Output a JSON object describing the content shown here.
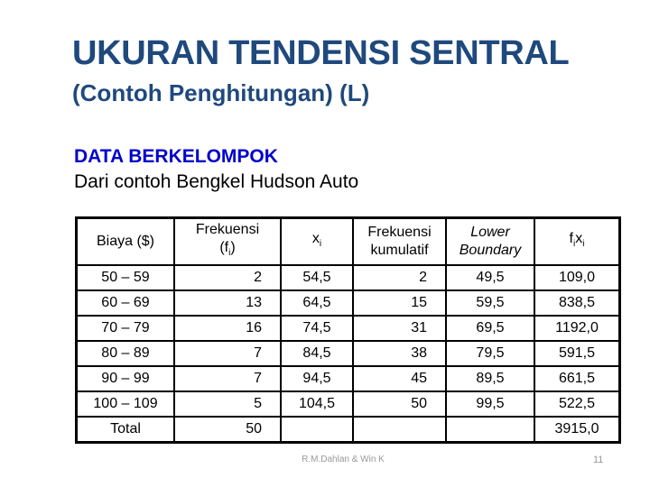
{
  "title": "UKURAN TENDENSI SENTRAL",
  "subtitle": "(Contoh Penghitungan) (L)",
  "section_heading": "DATA BERKELOMPOK",
  "section_subheading": "Dari contoh Bengkel Hudson Auto",
  "table": {
    "headers": [
      {
        "text": "Biaya ($)"
      },
      {
        "text": "Frekuensi",
        "line2": "(f",
        "sub": "i",
        "close": ")"
      },
      {
        "text": "x",
        "sub": "i"
      },
      {
        "text": "Frekuensi",
        "line2": "kumulatif"
      },
      {
        "text": "Lower",
        "line2": "Boundary"
      },
      {
        "text": "f",
        "sub": "i",
        "text2": "x",
        "sub2": "i"
      }
    ],
    "rows": [
      [
        "50 – 59",
        "2",
        "54,5",
        "2",
        "49,5",
        "109,0"
      ],
      [
        "60 – 69",
        "13",
        "64,5",
        "15",
        "59,5",
        "838,5"
      ],
      [
        "70 – 79",
        "16",
        "74,5",
        "31",
        "69,5",
        "1192,0"
      ],
      [
        "80 – 89",
        "7",
        "84,5",
        "38",
        "79,5",
        "591,5"
      ],
      [
        "90 – 99",
        "7",
        "94,5",
        "45",
        "89,5",
        "661,5"
      ],
      [
        "100 – 109",
        "5",
        "104,5",
        "50",
        "99,5",
        "522,5"
      ]
    ],
    "total": [
      "Total",
      "50",
      "",
      "",
      "",
      "3915,0"
    ]
  },
  "footer": "R.M.Dahlan & Win K",
  "page_number": "11"
}
